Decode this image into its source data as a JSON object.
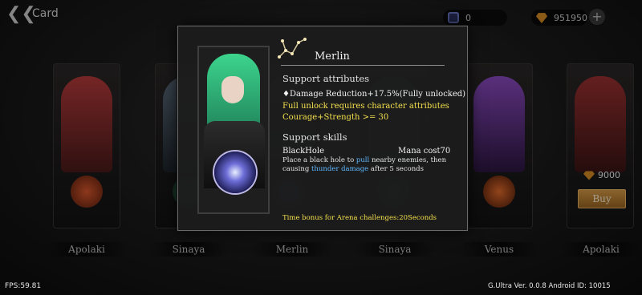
{
  "header": {
    "title": "Card",
    "tickets": "0",
    "gems": "951950"
  },
  "cards": [
    {
      "name": "Apolaki"
    },
    {
      "name": "Sinaya"
    },
    {
      "name": "Merlin"
    },
    {
      "name": "Sinaya"
    },
    {
      "name": "Venus"
    },
    {
      "name": "Apolaki",
      "price": "9000",
      "buy_label": "Buy"
    }
  ],
  "dialog": {
    "name": "Merlin",
    "support_attributes_title": "Support attributes",
    "attribute": "♦Damage Reduction+17.5%(Fully unlocked)",
    "unlock_note": "Full unlock requires character attributes",
    "requirement": "Courage+Strength >= 30",
    "support_skills_title": "Support skills",
    "skill_name": "BlackHole",
    "mana_cost": "Mana cost70",
    "desc": {
      "part1": "Place a black hole to ",
      "pull": "pull",
      "part2": " nearby enemies, then causing ",
      "thunder": "thunder damage",
      "part3": " after 5 seconds"
    },
    "bonus": "Time bonus for Arena challenges:20Seconds"
  },
  "footer": {
    "fps": "FPS:59.81",
    "version": "G.Ultra Ver. 0.0.8 Android ID: 10015"
  },
  "colors": {
    "highlight_yellow": "#f3e04c",
    "keyword_blue": "#5fb8ff",
    "buy_button": "#c58a3a"
  }
}
